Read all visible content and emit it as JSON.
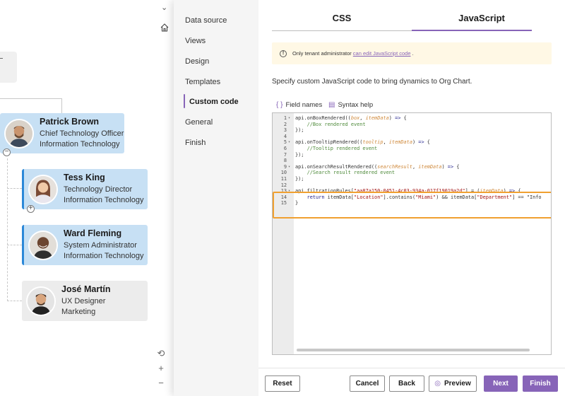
{
  "chart": {
    "chevron": "⌄",
    "nodes": [
      {
        "name": "Patrick Brown",
        "title": "Chief Technology Officer",
        "dept": "Information Technology"
      },
      {
        "name": "Tess King",
        "title": "Technology Director",
        "dept": "Information Technology"
      },
      {
        "name": "Ward Fleming",
        "title": "System Administrator",
        "dept": "Information Technology"
      },
      {
        "name": "José Martín",
        "title": "UX Designer",
        "dept": "Marketing"
      }
    ],
    "zoom_controls": {
      "reset": "⟲",
      "plus": "+",
      "minus": "−"
    }
  },
  "nav": {
    "items": [
      "Data source",
      "Views",
      "Design",
      "Templates",
      "Custom code",
      "General",
      "Finish"
    ],
    "active": "Custom code"
  },
  "tabs": {
    "css": "CSS",
    "javascript": "JavaScript",
    "active": "JavaScript"
  },
  "notice": {
    "before": "Only tenant administrator",
    "link": "can edit JavaScript code",
    "after": "."
  },
  "description": "Specify custom JavaScript code to bring dynamics to Org Chart.",
  "tools": {
    "field_names": "Field names",
    "syntax_help": "Syntax help"
  },
  "editor": {
    "lines": [
      "api.onBoxRendered((box, itemData) => {",
      "    //Box rendered event",
      "});",
      "",
      "api.onTooltipRendered((tooltip, itemData) => {",
      "    //Tooltip rendered event",
      "});",
      "",
      "api.onSearchResultRendered((searchResult, itemData) => {",
      "    //Search result rendered event",
      "});",
      "",
      "api.filtrationRules[\"aa87a150-0451-4c03-934a-017f19019a2d\"] = (itemData) => {",
      "    return itemData[\"Location\"].contains(\"Miami\") && itemData[\"Department\"] == \"Info",
      "}"
    ]
  },
  "footer": {
    "reset": "Reset",
    "cancel": "Cancel",
    "back": "Back",
    "preview": "Preview",
    "next": "Next",
    "finish": "Finish"
  },
  "colors": {
    "accent": "#8764b8",
    "node_blue": "#c7e0f4",
    "node_grey": "#ececec",
    "highlight": "#f0a030",
    "notice_bg": "#fff8e5"
  }
}
